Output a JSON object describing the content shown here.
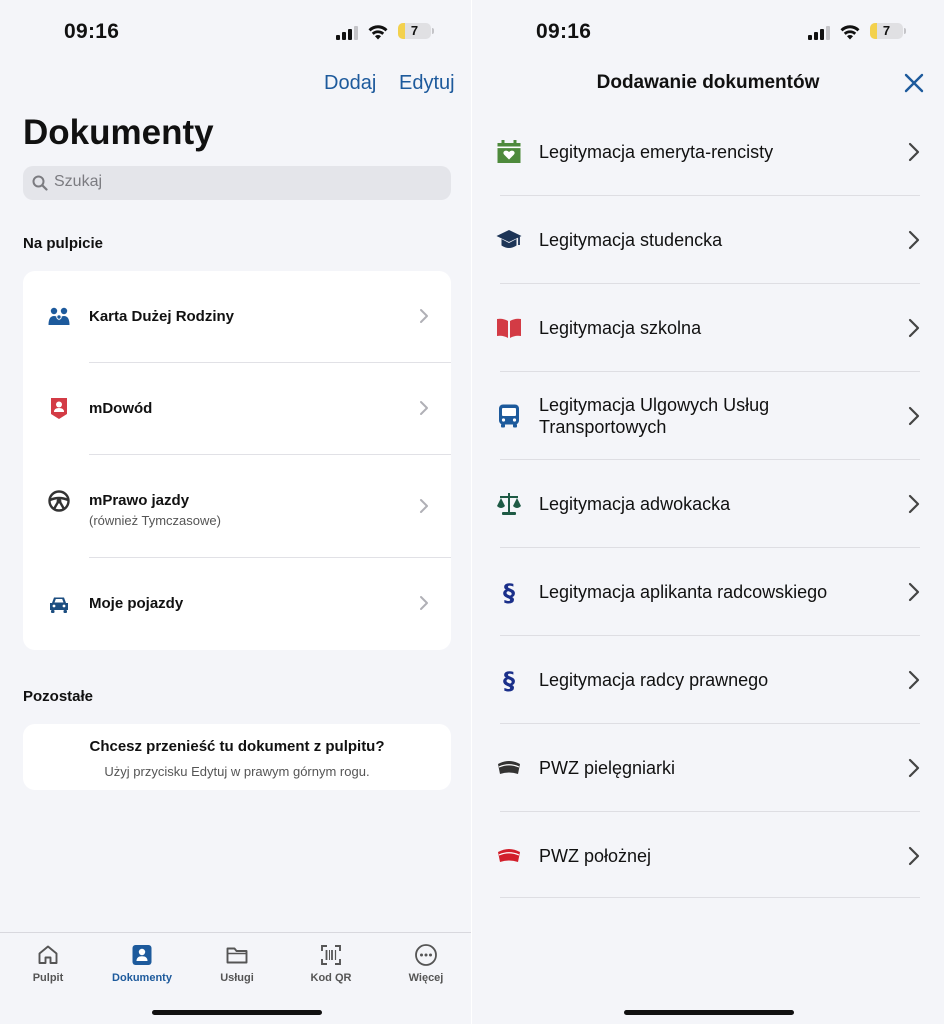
{
  "status_bar": {
    "time": "09:16",
    "battery": "7"
  },
  "left": {
    "nav": {
      "add": "Dodaj",
      "edit": "Edytuj"
    },
    "title": "Dokumenty",
    "search": {
      "placeholder": "Szukaj"
    },
    "desktop_section": "Na pulpicie",
    "desktop_items": [
      {
        "label": "Karta Dużej Rodziny",
        "icon": "family-icon"
      },
      {
        "label": "mDowód",
        "icon": "id-card-icon"
      },
      {
        "label": "mPrawo jazdy",
        "sublabel": "(również Tymczasowe)",
        "icon": "steering-wheel-icon"
      },
      {
        "label": "Moje pojazdy",
        "icon": "car-icon"
      }
    ],
    "other_section": "Pozostałe",
    "info": {
      "title": "Chcesz przenieść tu dokument z pulpitu?",
      "subtitle": "Użyj przycisku Edytuj w prawym górnym rogu."
    },
    "tabs": [
      {
        "label": "Pulpit",
        "icon": "home-icon",
        "active": false
      },
      {
        "label": "Dokumenty",
        "icon": "document-person-icon",
        "active": true
      },
      {
        "label": "Usługi",
        "icon": "folder-icon",
        "active": false
      },
      {
        "label": "Kod QR",
        "icon": "qr-scan-icon",
        "active": false
      },
      {
        "label": "Więcej",
        "icon": "more-icon",
        "active": false
      }
    ]
  },
  "right": {
    "title": "Dodawanie dokumentów",
    "documents": [
      {
        "label": "Legitymacja emeryta-rencisty",
        "icon": "calendar-heart-icon",
        "color": "#4e8a3c"
      },
      {
        "label": "Legitymacja studencka",
        "icon": "graduation-cap-icon",
        "color": "#1d3557"
      },
      {
        "label": "Legitymacja szkolna",
        "icon": "book-icon",
        "color": "#d33b45"
      },
      {
        "label": "Legitymacja Ulgowych Usług Transportowych",
        "icon": "bus-icon",
        "color": "#1d5a9c"
      },
      {
        "label": "Legitymacja adwokacka",
        "icon": "scales-icon",
        "color": "#1e5a45"
      },
      {
        "label": "Legitymacja aplikanta radcowskiego",
        "icon": "paragraph-icon",
        "color": "#1a2f8a"
      },
      {
        "label": "Legitymacja radcy prawnego",
        "icon": "paragraph-icon",
        "color": "#1a2f8a"
      },
      {
        "label": "PWZ pielęgniarki",
        "icon": "nurse-cap-icon",
        "color": "#333333"
      },
      {
        "label": "PWZ położnej",
        "icon": "nurse-cap-icon",
        "color": "#d21f2b"
      }
    ]
  },
  "colors": {
    "accent": "#1d5a9c",
    "background": "#f4f5f9"
  }
}
